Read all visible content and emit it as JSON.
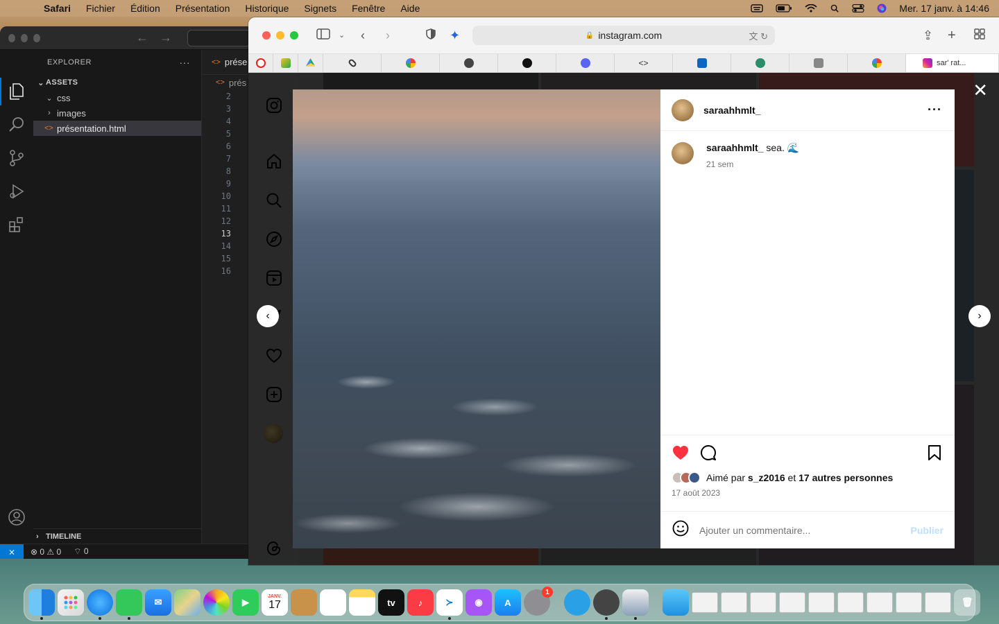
{
  "menubar": {
    "app_name": "Safari",
    "menus": [
      "Fichier",
      "Édition",
      "Présentation",
      "Historique",
      "Signets",
      "Fenêtre",
      "Aide"
    ],
    "datetime": "Mer. 17 janv. à  14:46"
  },
  "vscode": {
    "explorer_title": "EXPLORER",
    "more": "···",
    "section": "ASSETS",
    "folders": [
      "css",
      "images"
    ],
    "open_file": "présentation.html",
    "timeline": "TIMELINE",
    "tab_label": "prése",
    "breadcrumb": "prés",
    "line_numbers": [
      "2",
      "3",
      "4",
      "5",
      "6",
      "7",
      "8",
      "9",
      "10",
      "11",
      "12",
      "13",
      "14",
      "15",
      "16"
    ],
    "current_line": "13",
    "status": {
      "errors": "0",
      "warnings": "0",
      "ports": "0"
    }
  },
  "safari": {
    "url": "instagram.com",
    "active_tab_title": "sar' rat...",
    "favorites": [
      "opera",
      "stickman",
      "drive",
      "squarespace",
      "google",
      "github",
      "figma",
      "discord",
      "code",
      "linkedin",
      "turtle",
      "grammarly",
      "google2"
    ]
  },
  "instagram": {
    "username": "saraahhmlt_",
    "caption": "sea. 🌊",
    "time_ago": "21 sem",
    "liked_by_prefix": "Aimé par",
    "liked_by_user": "s_z2016",
    "liked_by_connector": "et",
    "liked_by_others": "17 autres personnes",
    "date": "17 août 2023",
    "comment_placeholder": "Ajouter un commentaire...",
    "publish": "Publier",
    "liked": true,
    "colors": {
      "like": "#ff3040",
      "publish_disabled": "#c0dffd"
    }
  },
  "dock": {
    "calendar_month": "JANV.",
    "calendar_day": "17",
    "settings_badge": "1"
  }
}
